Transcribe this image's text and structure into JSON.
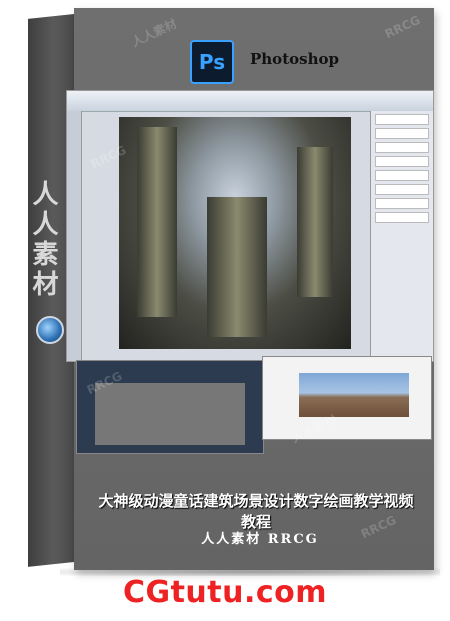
{
  "box": {
    "brand_icon": "Ps",
    "brand_name": "Photoshop",
    "spine_label": "人人素材",
    "title": "大神级动漫童话建筑场景设计数字绘画教学视频教程",
    "subtitle": "人人素材  RRCG"
  },
  "watermarks": [
    "RRCG",
    "人人素材"
  ],
  "footer": {
    "site": "CGtutu.com",
    "site_color": "#ee2222"
  },
  "colors": {
    "box_front": "#6a6a6a",
    "ps_blue": "#39a1ff"
  }
}
